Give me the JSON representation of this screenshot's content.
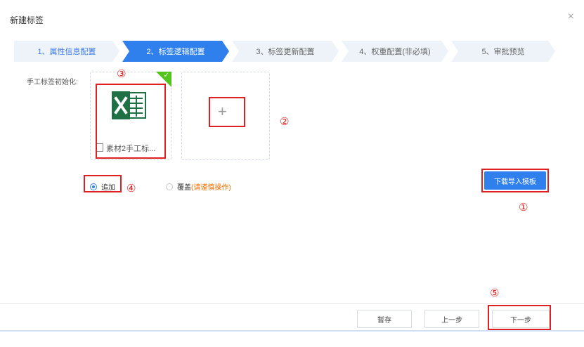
{
  "dialog": {
    "title": "新建标签",
    "close_glyph": "×"
  },
  "steps": [
    {
      "label": "1、属性信息配置"
    },
    {
      "label": "2、标签逻辑配置"
    },
    {
      "label": "3、标签更新配置"
    },
    {
      "label": "4、权重配置(非必填)"
    },
    {
      "label": "5、审批预览"
    }
  ],
  "active_step": 2,
  "form": {
    "field_label": "手工标签初始化:",
    "uploaded_file": {
      "name": "素材2手工标...",
      "icon": "excel-icon"
    },
    "upload_placeholder_icon": "plus-icon",
    "mode_options": {
      "append": "追加",
      "overwrite": "覆盖",
      "overwrite_warning": "(请谨慎操作)"
    },
    "selected_mode": "append",
    "download_template_label": "下载导入模板"
  },
  "footer": {
    "save_draft_label": "暂存",
    "prev_label": "上一步",
    "next_label": "下一步"
  },
  "annotations": [
    "①",
    "②",
    "③",
    "④",
    "⑤"
  ],
  "colors": {
    "primary": "#2f80ed",
    "annotation_red": "#e02020",
    "success_green": "#52c41a",
    "warning_orange": "#ff6a00"
  }
}
